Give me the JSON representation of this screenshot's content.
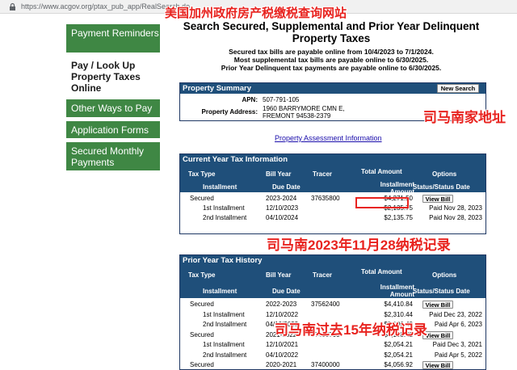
{
  "browser": {
    "url": "https://www.acgov.org/ptax_pub_app/RealSearch.do"
  },
  "sidebar": {
    "items": [
      {
        "label": "Payment Reminders"
      },
      {
        "label": "Pay / Look Up Property Taxes Online"
      },
      {
        "label": "Other Ways to Pay"
      },
      {
        "label": "Application Forms"
      },
      {
        "label": "Secured Monthly Payments"
      }
    ]
  },
  "page": {
    "title": "Search Secured, Supplemental and Prior Year Delinquent Property Taxes",
    "notices": [
      "Secured tax bills are payable online from 10/4/2023 to 7/1/2024.",
      "Most supplemental tax bills are payable online to 6/30/2025.",
      "Prior Year Delinquent tax payments are payable online to 6/30/2025."
    ]
  },
  "summary": {
    "heading": "Property Summary",
    "new_search": "New Search",
    "apn_label": "APN:",
    "apn": "507-791-105",
    "address_label": "Property Address:",
    "address": "1960 BARRYMORE CMN E, FREMONT 94538-2379"
  },
  "assessment_link": "Property Assessment Information",
  "current": {
    "heading": "Current Year Tax Information",
    "headers": {
      "tax_type": "Tax Type",
      "bill_year": "Bill Year",
      "tracer": "Tracer",
      "total": "Total Amount",
      "options": "Options",
      "installment": "Installment",
      "due_date": "Due Date",
      "inst_amount": "Installment Amount",
      "status": "Status/Status Date"
    },
    "rows": [
      {
        "type": "Secured",
        "year": "2023-2024",
        "tracer": "37635800",
        "amount": "$4,271.50",
        "opt": "View Bill"
      },
      {
        "type": "1st Installment",
        "year": "12/10/2023",
        "tracer": "",
        "amount": "$2,135.75",
        "opt": "Paid Nov 28, 2023"
      },
      {
        "type": "2nd Installment",
        "year": "04/10/2024",
        "tracer": "",
        "amount": "$2,135.75",
        "opt": "Paid Nov 28, 2023"
      }
    ]
  },
  "prior": {
    "heading": "Prior Year Tax History",
    "headers": {
      "tax_type": "Tax Type",
      "bill_year": "Bill Year",
      "tracer": "Tracer",
      "total": "Total Amount",
      "options": "Options",
      "installment": "Installment",
      "due_date": "Due Date",
      "inst_amount": "Installment Amount",
      "status": "Status/Status Date"
    },
    "rows": [
      {
        "type": "Secured",
        "year": "2022-2023",
        "tracer": "37562400",
        "amount": "$4,410.84",
        "opt": "View Bill"
      },
      {
        "type": "1st Installment",
        "year": "12/10/2022",
        "tracer": "",
        "amount": "$2,310.44",
        "opt": "Paid Dec 23, 2022"
      },
      {
        "type": "2nd Installment",
        "year": "04/10/2023",
        "tracer": "",
        "amount": "$2,100.40",
        "opt": "Paid Apr 6, 2023"
      },
      {
        "type": "Secured",
        "year": "2021-2022",
        "tracer": "37483700",
        "amount": "$4,108.42",
        "opt": "View Bill"
      },
      {
        "type": "1st Installment",
        "year": "12/10/2021",
        "tracer": "",
        "amount": "$2,054.21",
        "opt": "Paid Dec 3, 2021"
      },
      {
        "type": "2nd Installment",
        "year": "04/10/2022",
        "tracer": "",
        "amount": "$2,054.21",
        "opt": "Paid Apr 5, 2022"
      },
      {
        "type": "Secured",
        "year": "2020-2021",
        "tracer": "37400000",
        "amount": "$4,056.92",
        "opt": "View Bill"
      }
    ]
  },
  "annotations": {
    "top": "美国加州政府房产税缴税查询网站",
    "address": "司马南家地址",
    "current": "司马南2023年11月28纳税记录",
    "prior": "司马南过去15年纳税记录"
  },
  "colors": {
    "sidebar_green": "#3f8744",
    "table_header": "#1f4f7a",
    "annotation_red": "#e8231f"
  }
}
